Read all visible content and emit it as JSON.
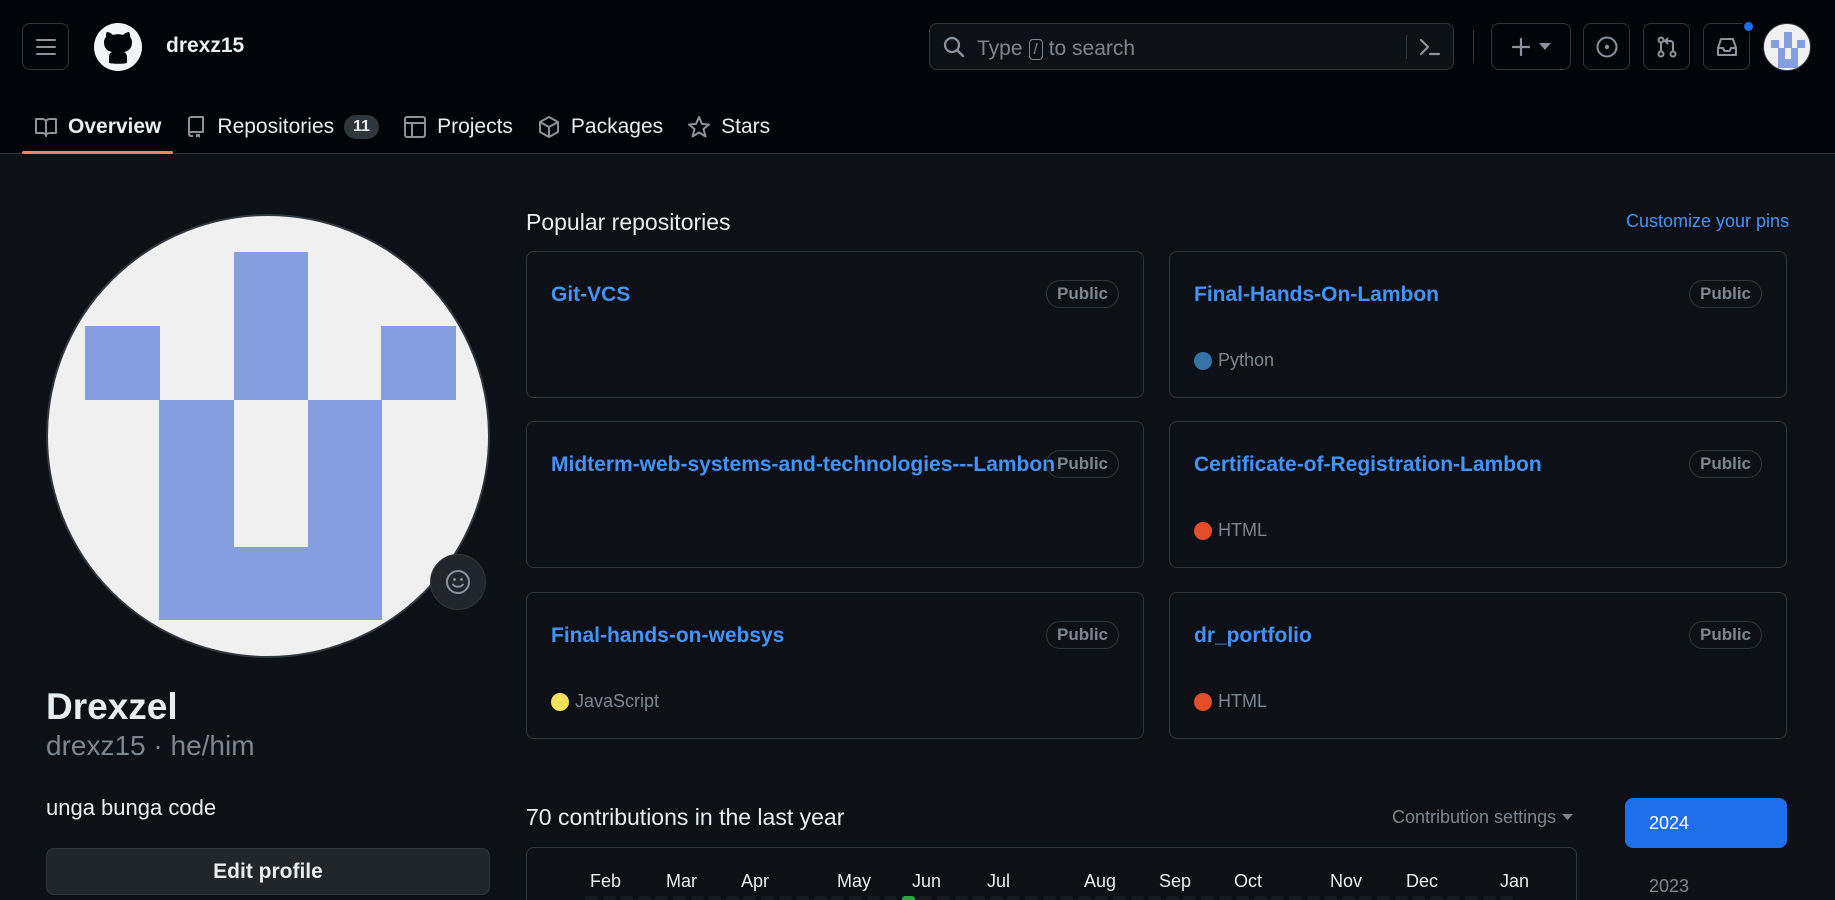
{
  "header": {
    "username": "drexz15",
    "search": {
      "prefix": "Type",
      "key": "/",
      "suffix": "to search"
    }
  },
  "tabs": [
    {
      "label": "Overview",
      "icon": "book-icon"
    },
    {
      "label": "Repositories",
      "icon": "repo-icon",
      "count": "11"
    },
    {
      "label": "Projects",
      "icon": "table-icon"
    },
    {
      "label": "Packages",
      "icon": "package-icon"
    },
    {
      "label": "Stars",
      "icon": "star-icon"
    }
  ],
  "profile": {
    "display_name": "Drexzel",
    "login_line": "drexz15 · he/him",
    "bio": "unga bunga code",
    "edit_label": "Edit profile"
  },
  "popular": {
    "title": "Popular repositories",
    "customize_label": "Customize your pins",
    "repos": [
      {
        "name": "Git-VCS",
        "visibility": "Public",
        "language": "",
        "lang_color": ""
      },
      {
        "name": "Final-Hands-On-Lambon",
        "visibility": "Public",
        "language": "Python",
        "lang_color": "#3572A5"
      },
      {
        "name": "Midterm-web-systems-and-technologies---Lambon",
        "visibility": "Public",
        "language": "",
        "lang_color": ""
      },
      {
        "name": "Certificate-of-Registration-Lambon",
        "visibility": "Public",
        "language": "HTML",
        "lang_color": "#e34c26"
      },
      {
        "name": "Final-hands-on-websys",
        "visibility": "Public",
        "language": "JavaScript",
        "lang_color": "#f1e05a"
      },
      {
        "name": "dr_portfolio",
        "visibility": "Public",
        "language": "HTML",
        "lang_color": "#e34c26"
      }
    ]
  },
  "contributions": {
    "title": "70 contributions in the last year",
    "settings_label": "Contribution settings",
    "months": [
      "Feb",
      "Mar",
      "Apr",
      "May",
      "Jun",
      "Jul",
      "Aug",
      "Sep",
      "Oct",
      "Nov",
      "Dec",
      "Jan"
    ],
    "years": [
      "2024",
      "2023"
    ],
    "selected_year": "2024"
  },
  "colors": {
    "accent": "#4493f8",
    "tab_underline": "#f78166",
    "primary_button": "#1f6feb",
    "avatar_pattern": "#859ee0"
  }
}
